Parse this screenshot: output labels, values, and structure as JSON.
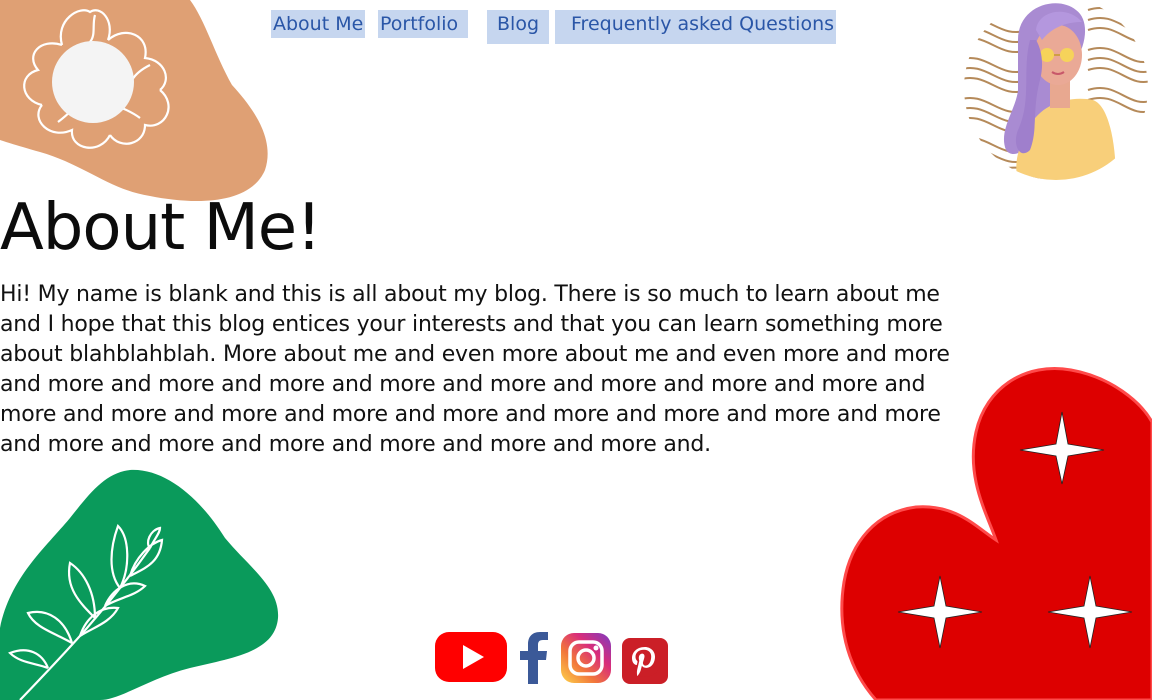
{
  "nav": {
    "items": [
      {
        "label": "About Me"
      },
      {
        "label": "Portfolio"
      },
      {
        "label": "Blog"
      },
      {
        "label": "Frequently asked Questions"
      }
    ]
  },
  "page": {
    "title": "About Me!",
    "intro": "Hi! My name is blank and this is all about my blog. There is so much to learn about me and I hope that this blog entices your interests and that you can learn something more about blahblahblah. More about me and even more about me and even more and more and more and more and more and more and more and more and more and more and more and more and more and more and more and more and more and more and more and more and more and more and more and more and more and."
  },
  "social": {
    "icons": [
      "youtube-icon",
      "facebook-icon",
      "instagram-icon",
      "pinterest-icon"
    ]
  },
  "colors": {
    "orange_blob": "#dfa074",
    "green_blob": "#0a9a5b",
    "red_blob": "#dd0000",
    "nav_bg": "#c6d6ef",
    "nav_text": "#2a56a7"
  }
}
